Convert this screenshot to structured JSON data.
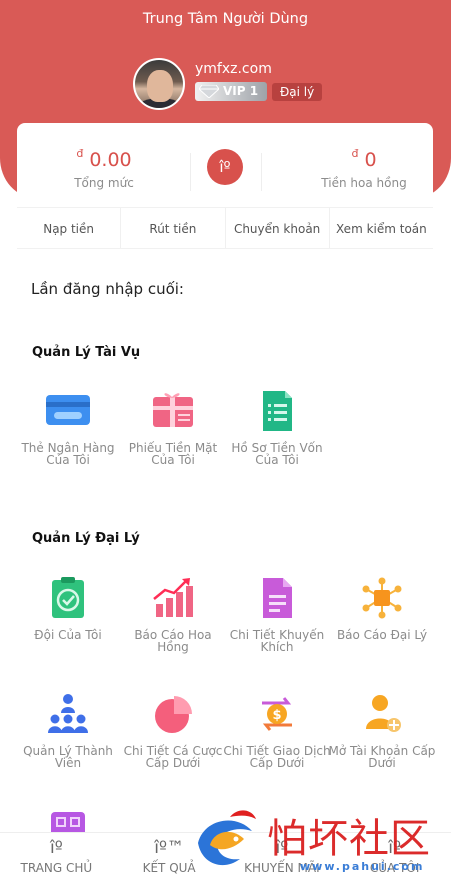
{
  "header": {
    "title": "Trung Tâm Người Dùng",
    "username": "ymfxz.com",
    "vip_label": "VIP 1",
    "agent_label": "Đại lý"
  },
  "balance": {
    "currency": "đ",
    "total_value": "0.00",
    "total_label": "Tổng mức",
    "center_icon": "îº",
    "commission_value": "0",
    "commission_label": "Tiền hoa hồng"
  },
  "actions": [
    "Nạp tiền",
    "Rút tiền",
    "Chuyển khoản",
    "Xem kiểm toán"
  ],
  "last_login": "Lần đăng nhập cuối:",
  "finance": {
    "title": "Quản Lý Tài Vụ",
    "items": [
      {
        "label": "Thẻ Ngân Hàng Của Tôi",
        "icon": "bank-card-icon"
      },
      {
        "label": "Phiếu Tiền Mặt Của Tôi",
        "icon": "gift-voucher-icon"
      },
      {
        "label": "Hồ Sơ Tiền Vốn Của Tôi",
        "icon": "fund-record-icon"
      }
    ]
  },
  "agency": {
    "title": "Quản Lý Đại Lý",
    "items": [
      {
        "label": "Đội Của Tôi",
        "icon": "team-clipboard-icon"
      },
      {
        "label": "Báo Cáo Hoa Hồng",
        "icon": "commission-chart-icon"
      },
      {
        "label": "Chi Tiết Khuyến Khích",
        "icon": "incentive-document-icon"
      },
      {
        "label": "Báo Cáo Đại Lý",
        "icon": "agent-network-icon"
      },
      {
        "label": "Quản Lý Thành Viên",
        "icon": "members-icon"
      },
      {
        "label": "Chi Tiết Cá Cược Cấp Dưới",
        "icon": "pie-chart-icon"
      },
      {
        "label": "Chi Tiết Giao Dịch Cấp Dưới",
        "icon": "coin-transfer-icon"
      },
      {
        "label": "Mở Tài Khoản Cấp Dưới",
        "icon": "add-user-icon"
      }
    ]
  },
  "bottom_nav": [
    {
      "icon": "îº",
      "label": "TRANG CHỦ"
    },
    {
      "icon": "îº™",
      "label": "KẾT QUẢ"
    },
    {
      "icon": "îº",
      "label": "KHUYẾN MÃI"
    },
    {
      "icon": "îº",
      "label": "CỦA TÔI"
    }
  ],
  "watermark": {
    "text": "怕坏社区",
    "url": "www.pahui.com"
  },
  "colors": {
    "brand_red": "#d95a56",
    "balance_red": "#d8514c"
  }
}
